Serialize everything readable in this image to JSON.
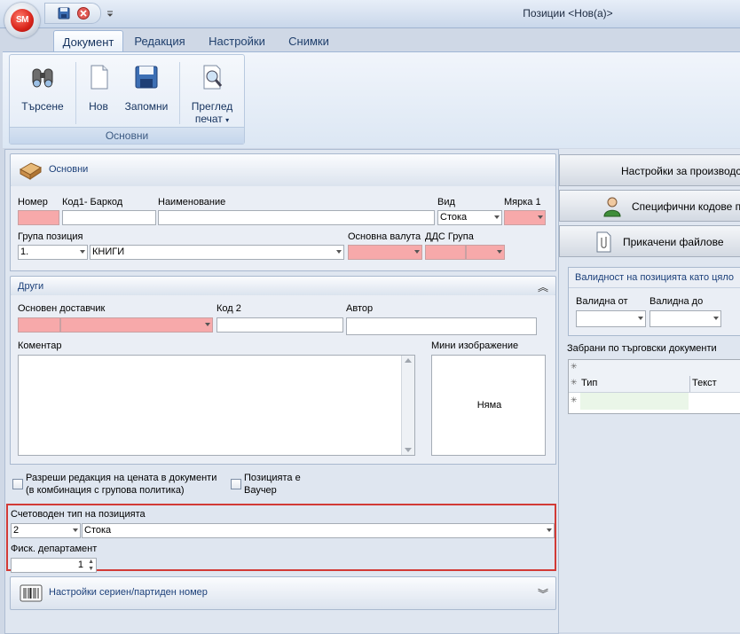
{
  "window": {
    "title": "Позиции <Нов(а)>",
    "logo_text": "SM"
  },
  "ribbon": {
    "tabs": [
      "Документ",
      "Редакция",
      "Настройки",
      "Снимки"
    ],
    "buttons": {
      "search": "Търсене",
      "new": "Нов",
      "save": "Запомни",
      "preview_line1": "Преглед",
      "preview_line2": "печат"
    },
    "group_label": "Основни"
  },
  "basic": {
    "header": "Основни",
    "labels": {
      "number": "Номер",
      "code": "Код1- Баркод",
      "name": "Наименование",
      "kind": "Вид",
      "unit": "Мярка 1",
      "group": "Група позиция",
      "currency": "Основна валута",
      "vat": "ДДС Група"
    },
    "values": {
      "kind": "Стока",
      "group_code": "1.",
      "group_name": "КНИГИ"
    }
  },
  "other": {
    "header": "Други",
    "labels": {
      "supplier": "Основен доставчик",
      "code2": "Код 2",
      "author": "Автор",
      "comment": "Коментар",
      "thumbnail": "Мини изображение"
    },
    "thumbnail_text": "Няма"
  },
  "checks": {
    "allow_price_edit_line1": "Разреши редакция на цената в документи",
    "allow_price_edit_line2": "(в комбинация с групова политика)",
    "voucher_line1": "Позицията е",
    "voucher_line2": "Ваучер"
  },
  "accounting": {
    "type_label": "Счетоводен тип на позицията",
    "type_code": "2",
    "type_name": "Стока",
    "fiscal_label": "Фиск. департамент",
    "fiscal_value": "1"
  },
  "serial": {
    "header": "Настройки сериен/партиден номер"
  },
  "right": {
    "production_button": "Настройки за производство",
    "codes_button": "Специфични кодове по",
    "attached_button": "Прикачени файлове",
    "validity_header": "Валидност на позицията като цяло",
    "valid_from": "Валидна от",
    "valid_to": "Валидна до",
    "forbidden_label": "Забрани по търговски документи",
    "grid_columns": [
      "Тип",
      "Текст"
    ]
  },
  "colors": {
    "required": "#f7a9aa",
    "highlight_border": "#d23a36",
    "accent_text": "#1b3f79"
  }
}
